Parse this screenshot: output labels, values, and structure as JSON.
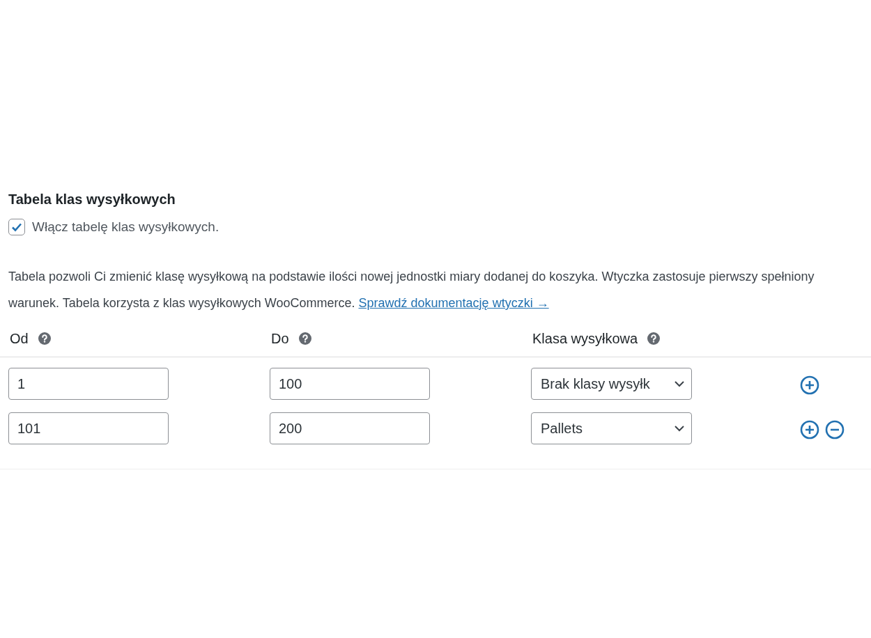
{
  "section": {
    "title": "Tabela klas wysyłkowych",
    "enable": {
      "label": "Włącz tabelę klas wysyłkowych.",
      "checked": true
    },
    "description": "Tabela pozwoli Ci zmienić klasę wysyłkową na podstawie ilości nowej jednostki miary dodanej do koszyka. Wtyczka zastosuje pierwszy spełniony warunek. Tabela korzysta z klas wysyłkowych WooCommerce.",
    "link": "Sprawdź dokumentację wtyczki →"
  },
  "table": {
    "columns": [
      {
        "label": "Od",
        "help": true
      },
      {
        "label": "Do",
        "help": true
      },
      {
        "label": "Klasa wysyłkowa",
        "help": true
      }
    ],
    "rows": [
      {
        "from": "1",
        "to": "100",
        "class": "Brak klasy wysyłk",
        "actions": [
          {
            "kind": "add"
          }
        ]
      },
      {
        "from": "101",
        "to": "200",
        "class": "Pallets",
        "actions": [
          {
            "kind": "add"
          },
          {
            "kind": "remove"
          }
        ]
      }
    ]
  }
}
